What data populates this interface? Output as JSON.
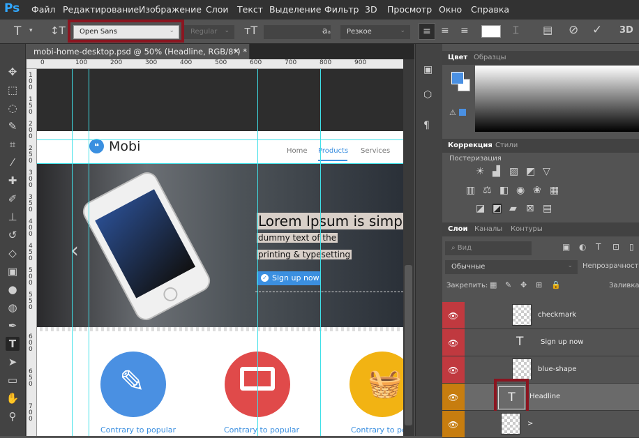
{
  "app": {
    "logo": "Ps"
  },
  "menu": [
    "Файл",
    "Редактирование",
    "Изображение",
    "Слои",
    "Текст",
    "Выделение",
    "Фильтр",
    "3D",
    "Просмотр",
    "Окно",
    "Справка"
  ],
  "options": {
    "font_family": "Open Sans",
    "font_style": "Regular",
    "antialias": "Резкое",
    "highlight_color": "#8b1520"
  },
  "document": {
    "tab_title": "mobi-home-desktop.psd @ 50% (Headline, RGB/8*) *",
    "close": "×",
    "ruler_h": [
      "0",
      "100",
      "200",
      "300",
      "400",
      "500",
      "600",
      "700",
      "800",
      "900"
    ],
    "ruler_v": [
      "1 0 0",
      "1 5 0",
      "2 0 0",
      "2 5 0",
      "3 0 0",
      "3 5 0",
      "4 0 0",
      "4 5 0",
      "5 0 0",
      "5 5 0",
      "6 0 0",
      "6 5 0",
      "7 0 0"
    ]
  },
  "site": {
    "brand": "Mobi",
    "brand_mark": "❝",
    "nav": [
      "Home",
      "Products",
      "Services"
    ],
    "headline": "Lorem Ipsum is simpl",
    "sub1": "dummy text of the",
    "sub2": "printing & typesetting",
    "signup": "Sign up now",
    "feature_label": "Contrary to popular",
    "colors": {
      "blue": "#4a90e2",
      "red": "#e04a4a",
      "yellow": "#f2b313"
    }
  },
  "panels": {
    "color_tabs": [
      "Цвет",
      "Образцы"
    ],
    "adjust_tabs": [
      "Коррекция",
      "Стили"
    ],
    "adjust_label": "Постеризация",
    "layer_tabs": [
      "Слои",
      "Каналы",
      "Контуры"
    ],
    "search_placeholder": "Вид",
    "blend_mode": "Обычные",
    "opacity_label": "Непрозрачность:",
    "lock_label": "Закрепить:",
    "fill_label": "Заливка:",
    "layers": [
      {
        "name": "checkmark"
      },
      {
        "name": "Sign up now"
      },
      {
        "name": "blue-shape"
      },
      {
        "name": "Headline"
      },
      {
        "name": ">"
      }
    ]
  }
}
